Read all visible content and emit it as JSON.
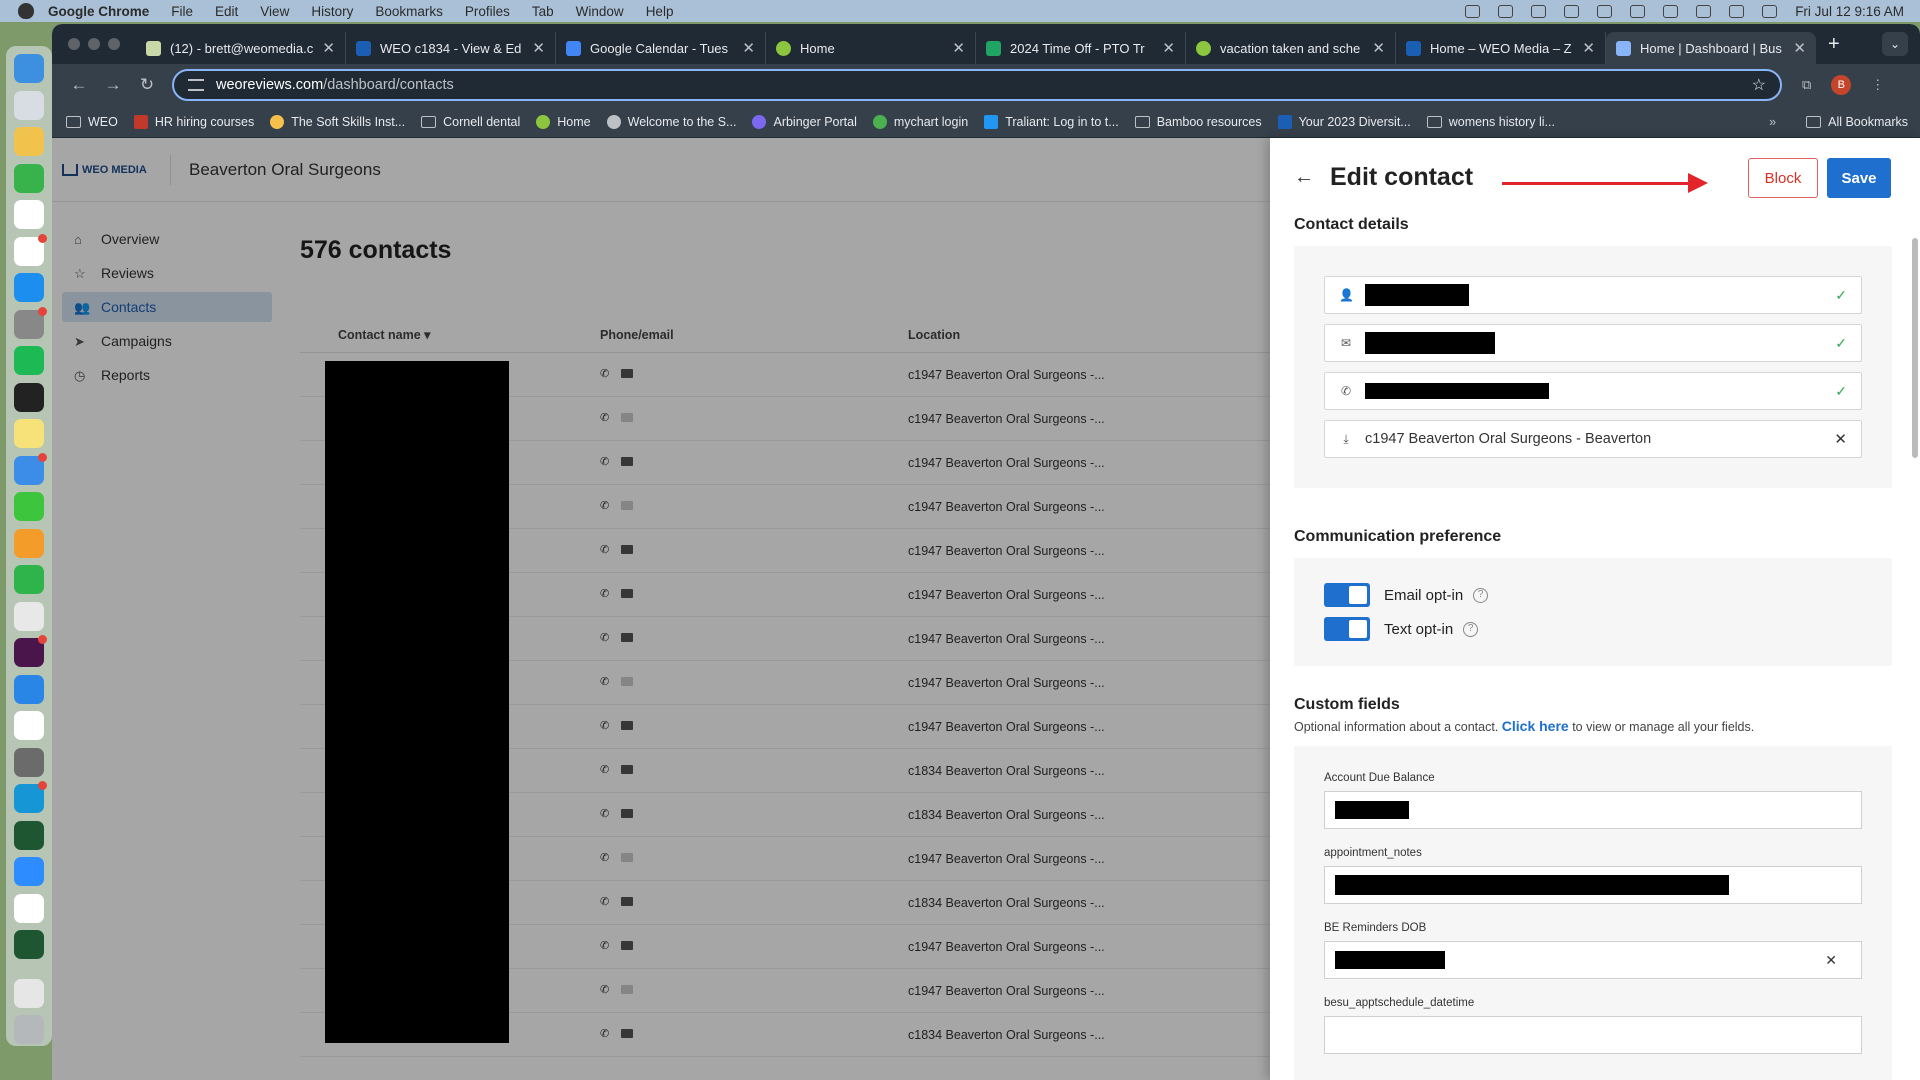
{
  "menubar": {
    "app_name": "Google Chrome",
    "items": [
      "File",
      "Edit",
      "View",
      "History",
      "Bookmarks",
      "Profiles",
      "Tab",
      "Window",
      "Help"
    ],
    "clock": "Fri Jul 12  9:16 AM"
  },
  "tabs": [
    {
      "title": "(12) - brett@weomedia.c",
      "color": "#c9d8a7"
    },
    {
      "title": "WEO c1834 - View & Ed",
      "color": "#1b5fb4"
    },
    {
      "title": "Google Calendar - Tues",
      "color": "#4285f4"
    },
    {
      "title": "Home",
      "color": "#8cc63f"
    },
    {
      "title": "2024 Time Off - PTO Tr",
      "color": "#1fa463"
    },
    {
      "title": "vacation taken and sche",
      "color": "#8cc63f"
    },
    {
      "title": "Home – WEO Media – Z",
      "color": "#1b5fb4"
    },
    {
      "title": "Home | Dashboard | Bus",
      "color": "#8ab4f8"
    }
  ],
  "url": {
    "host": "weoreviews.com",
    "path": "/dashboard/contacts"
  },
  "bookmarks": [
    {
      "label": "WEO",
      "type": "folder"
    },
    {
      "label": "HR hiring courses",
      "type": "site",
      "color": "#c0392b"
    },
    {
      "label": "The Soft Skills Inst...",
      "type": "site",
      "color": "#f5c04b"
    },
    {
      "label": "Cornell dental",
      "type": "folder"
    },
    {
      "label": "Home",
      "type": "site",
      "color": "#8cc63f"
    },
    {
      "label": "Welcome to the S...",
      "type": "site",
      "color": "#bdc1c6"
    },
    {
      "label": "Arbinger Portal",
      "type": "site",
      "color": "#7b68ee"
    },
    {
      "label": "mychart login",
      "type": "site",
      "color": "#4caf50"
    },
    {
      "label": "Traliant: Log in to t...",
      "type": "site",
      "color": "#2196f3"
    },
    {
      "label": "Bamboo resources",
      "type": "folder"
    },
    {
      "label": "Your 2023 Diversit...",
      "type": "site",
      "color": "#1b5fb4"
    },
    {
      "label": "womens history li...",
      "type": "folder"
    }
  ],
  "all_bookmarks": "All Bookmarks",
  "app": {
    "logo_text": "WEO MEDIA",
    "practice": "Beaverton Oral Surgeons",
    "nav": [
      {
        "label": "Overview",
        "icon": "home-icon"
      },
      {
        "label": "Reviews",
        "icon": "star-icon"
      },
      {
        "label": "Contacts",
        "icon": "people-icon",
        "active": true
      },
      {
        "label": "Campaigns",
        "icon": "send-icon"
      },
      {
        "label": "Reports",
        "icon": "clock-icon"
      }
    ],
    "count": "576 contacts",
    "columns": {
      "name": "Contact name",
      "phone": "Phone/email",
      "location": "Location"
    },
    "rows": [
      {
        "loc": "c1947 Beaverton Oral Surgeons -...",
        "email": true
      },
      {
        "loc": "c1947 Beaverton Oral Surgeons -...",
        "email": false
      },
      {
        "loc": "c1947 Beaverton Oral Surgeons -...",
        "email": true
      },
      {
        "loc": "c1947 Beaverton Oral Surgeons -...",
        "email": false
      },
      {
        "loc": "c1947 Beaverton Oral Surgeons -...",
        "email": true
      },
      {
        "loc": "c1947 Beaverton Oral Surgeons -...",
        "email": true
      },
      {
        "loc": "c1947 Beaverton Oral Surgeons -...",
        "email": true
      },
      {
        "loc": "c1947 Beaverton Oral Surgeons -...",
        "email": false
      },
      {
        "loc": "c1947 Beaverton Oral Surgeons -...",
        "email": true
      },
      {
        "loc": "c1834 Beaverton Oral Surgeons -...",
        "email": true
      },
      {
        "loc": "c1834 Beaverton Oral Surgeons -...",
        "email": true
      },
      {
        "loc": "c1947 Beaverton Oral Surgeons -...",
        "email": false
      },
      {
        "loc": "c1834 Beaverton Oral Surgeons -...",
        "email": true
      },
      {
        "loc": "c1947 Beaverton Oral Surgeons -...",
        "email": true
      },
      {
        "loc": "c1947 Beaverton Oral Surgeons -...",
        "email": false
      },
      {
        "loc": "c1834 Beaverton Oral Surgeons -...",
        "email": true
      }
    ]
  },
  "drawer": {
    "title": "Edit contact",
    "block": "Block",
    "save": "Save",
    "contact_details": "Contact details",
    "location_value": "c1947 Beaverton Oral Surgeons - Beaverton",
    "comm_pref": "Communication preference",
    "email_optin": "Email opt-in",
    "text_optin": "Text opt-in",
    "custom_fields": "Custom fields",
    "custom_sub_pre": "Optional information about a contact.",
    "custom_link": "Click here",
    "custom_sub_post": "to view or manage all your fields.",
    "cf": {
      "balance": "Account Due Balance",
      "notes": "appointment_notes",
      "dob": "BE Reminders DOB",
      "appt": "besu_apptschedule_datetime"
    }
  }
}
